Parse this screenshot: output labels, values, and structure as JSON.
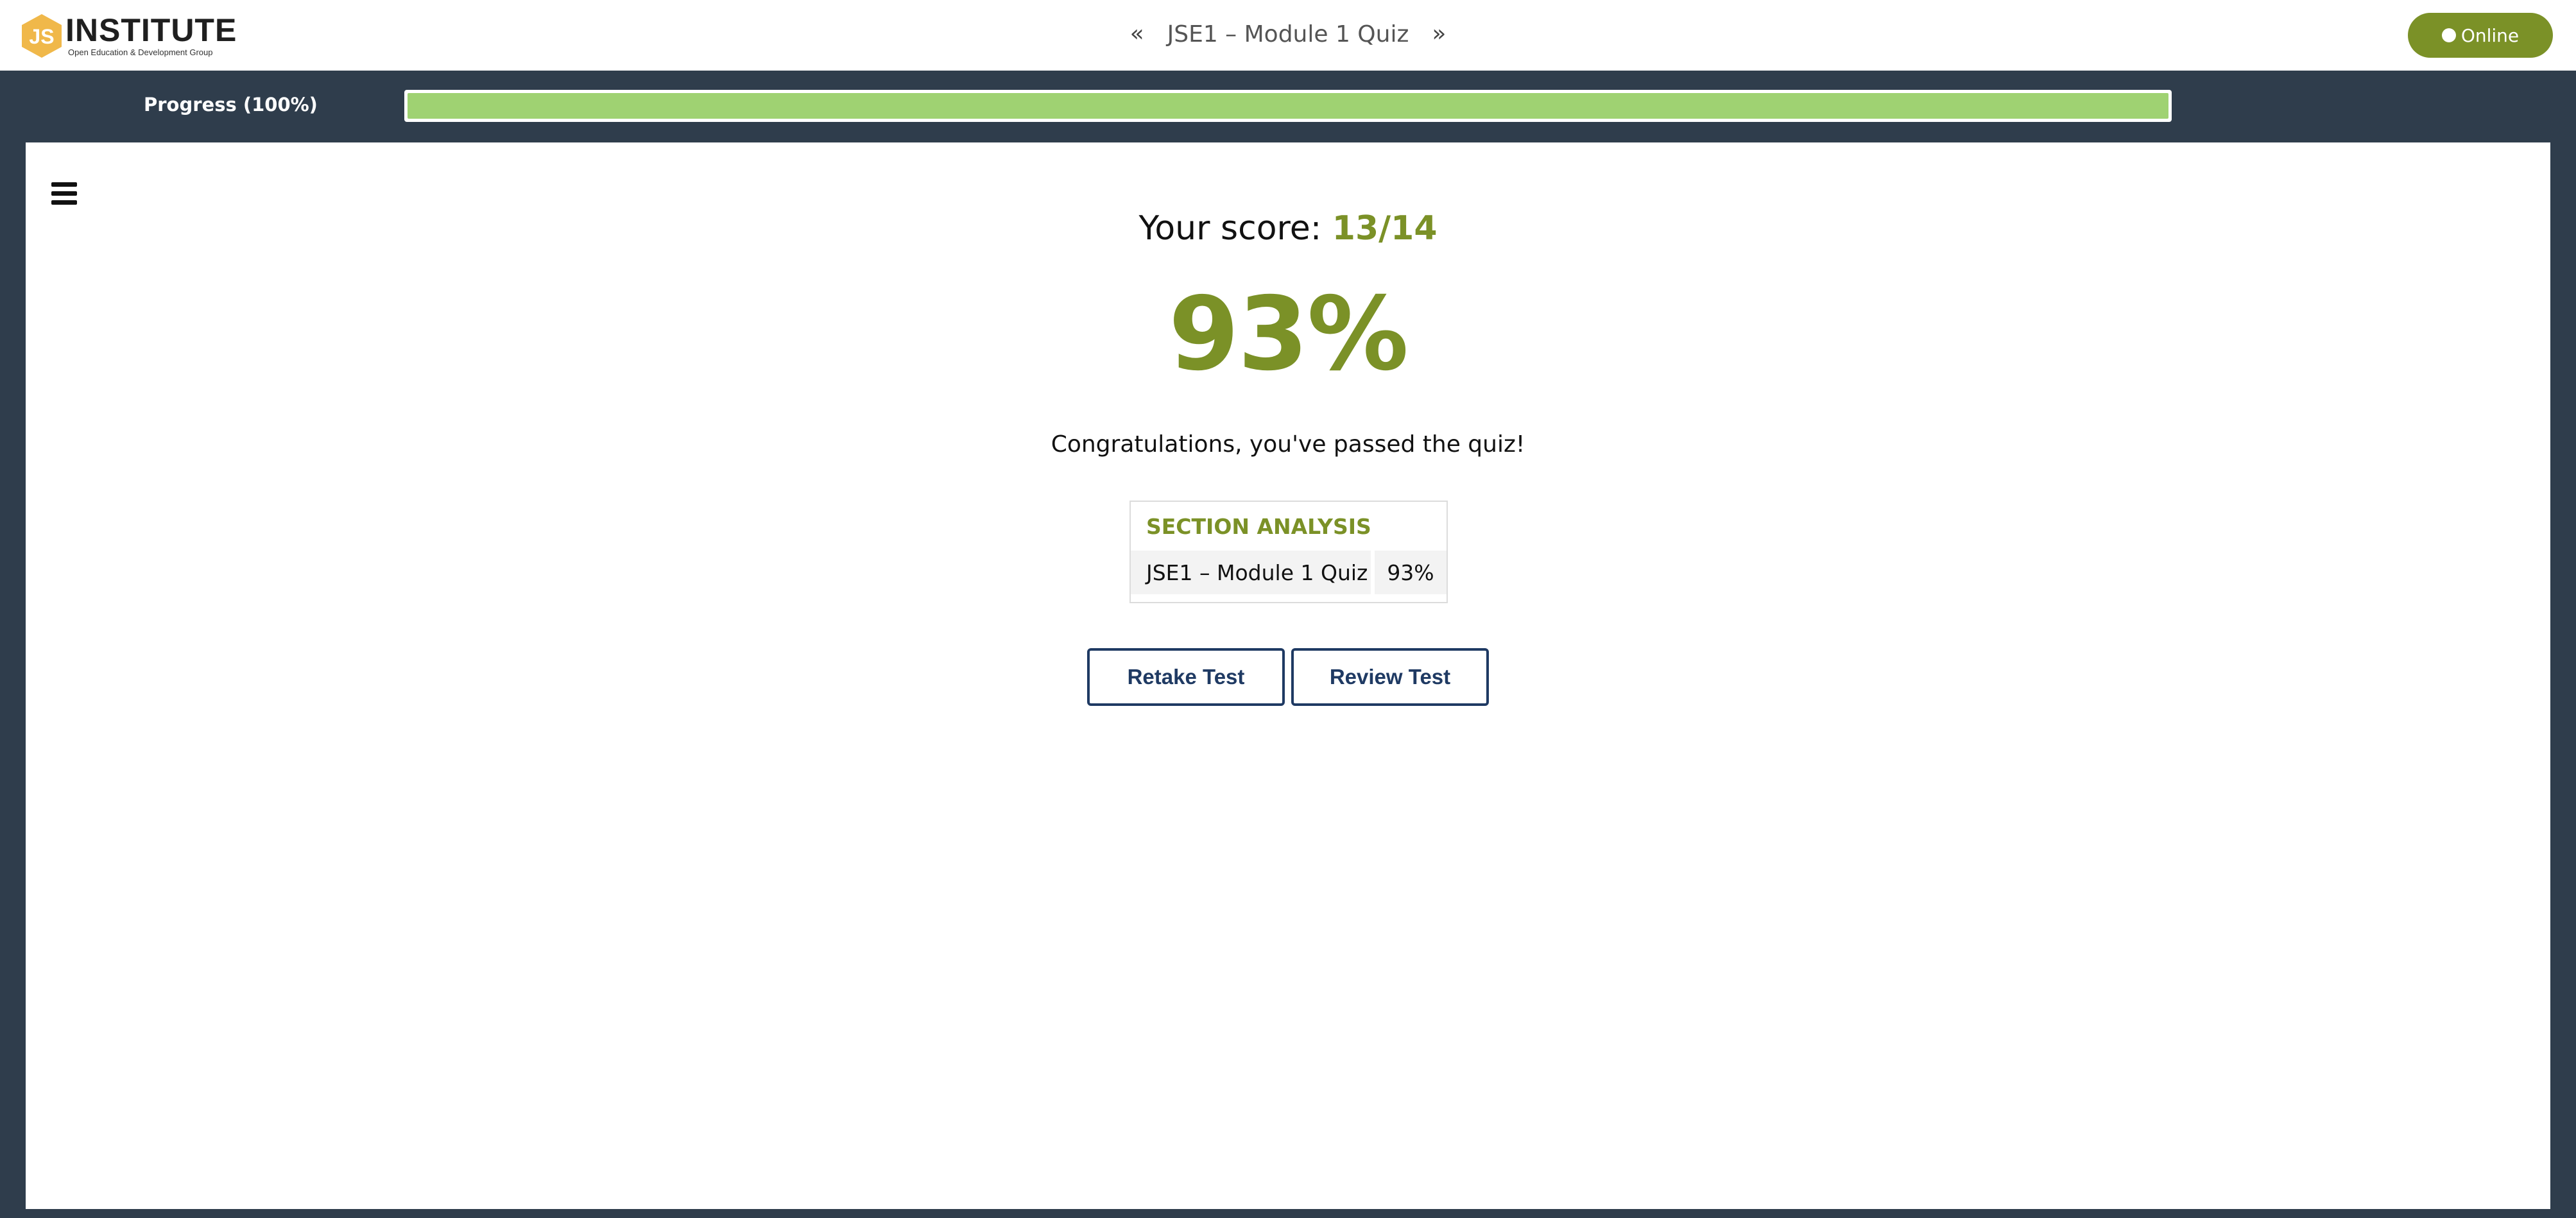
{
  "header": {
    "logo": {
      "mark": "JS",
      "word": "INSTITUTE",
      "tagline": "Open Education & Development Group",
      "accent_color": "#f0b84a"
    },
    "quiz_nav": {
      "prev_icon": "double-chevron-left-icon",
      "title": "JSE1 – Module 1 Quiz",
      "next_icon": "double-chevron-right-icon"
    },
    "status_button": {
      "label": "Online",
      "color": "#7b9127"
    }
  },
  "progress": {
    "label": "Progress (100%)",
    "value": 1.0,
    "fill_color": "#9fd272"
  },
  "result": {
    "menu_icon": "hamburger-menu-icon",
    "score_prefix": "Your score: ",
    "score_value": "13/14",
    "percent": "93%",
    "message": "Congratulations, you've passed the quiz!",
    "accent_color": "#7b9127"
  },
  "section_analysis": {
    "title": "SECTION ANALYSIS",
    "rows": [
      {
        "name": "JSE1 – Module 1 Quiz",
        "percent": "93%"
      }
    ]
  },
  "actions": {
    "retake_label": "Retake Test",
    "review_label": "Review Test",
    "border_color": "#1f3a63"
  }
}
